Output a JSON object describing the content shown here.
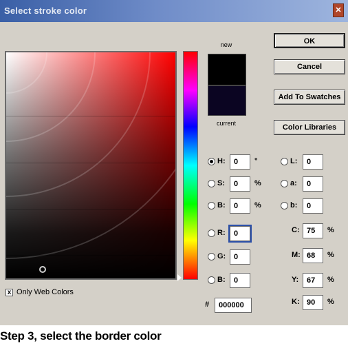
{
  "dialog": {
    "title": "Select stroke color",
    "close_icon": "close-icon",
    "preview": {
      "new_label": "new",
      "current_label": "current",
      "new_color": "#000000",
      "current_color": "#0b0522"
    },
    "buttons": {
      "ok": "OK",
      "cancel": "Cancel",
      "add_to_swatches": "Add To Swatches",
      "color_libraries": "Color Libraries"
    },
    "hsb": [
      {
        "id": "h",
        "label": "H:",
        "value": "0",
        "unit": "°",
        "selected": true
      },
      {
        "id": "s",
        "label": "S:",
        "value": "0",
        "unit": "%",
        "selected": false
      },
      {
        "id": "b",
        "label": "B:",
        "value": "0",
        "unit": "%",
        "selected": false
      }
    ],
    "rgb": [
      {
        "id": "r",
        "label": "R:",
        "value": "0",
        "selected": false
      },
      {
        "id": "g",
        "label": "G:",
        "value": "0",
        "selected": false
      },
      {
        "id": "b2",
        "label": "B:",
        "value": "0",
        "selected": false
      }
    ],
    "lab": [
      {
        "id": "l",
        "label": "L:",
        "value": "0",
        "selected": false
      },
      {
        "id": "a",
        "label": "a:",
        "value": "0",
        "selected": false
      },
      {
        "id": "bb",
        "label": "b:",
        "value": "0",
        "selected": false
      }
    ],
    "cmyk": [
      {
        "id": "c",
        "label": "C:",
        "value": "75",
        "unit": "%"
      },
      {
        "id": "m",
        "label": "M:",
        "value": "68",
        "unit": "%"
      },
      {
        "id": "y",
        "label": "Y:",
        "value": "67",
        "unit": "%"
      },
      {
        "id": "k",
        "label": "K:",
        "value": "90",
        "unit": "%"
      }
    ],
    "hex": {
      "label": "#",
      "value": "000000"
    },
    "only_web_colors": {
      "label": "Only Web Colors",
      "checked": true,
      "mark": "x"
    },
    "accent_color": "#ff0000"
  },
  "caption": "Step 3, select the border color"
}
